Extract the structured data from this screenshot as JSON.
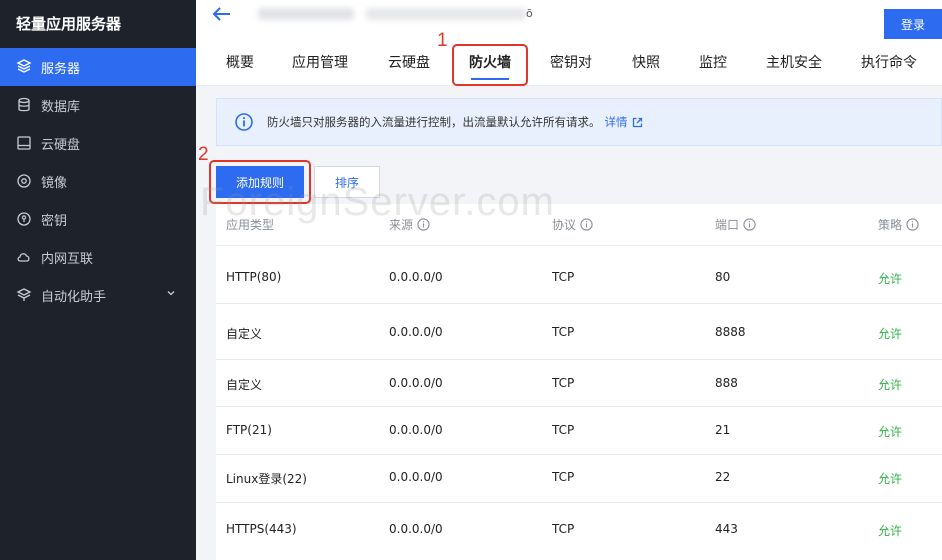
{
  "sidebar": {
    "brand": "轻量应用服务器",
    "items": [
      {
        "label": "服务器",
        "icon": "server-icon"
      },
      {
        "label": "数据库",
        "icon": "database-icon"
      },
      {
        "label": "云硬盘",
        "icon": "disk-icon"
      },
      {
        "label": "镜像",
        "icon": "image-icon"
      },
      {
        "label": "密钥",
        "icon": "key-icon"
      },
      {
        "label": "内网互联",
        "icon": "cloud-link-icon"
      },
      {
        "label": "自动化助手",
        "icon": "automation-icon"
      }
    ]
  },
  "header": {
    "title_fragment": "ō",
    "login_label": "登录"
  },
  "tabs": [
    {
      "label": "概要"
    },
    {
      "label": "应用管理"
    },
    {
      "label": "云硬盘"
    },
    {
      "label": "防火墙"
    },
    {
      "label": "密钥对"
    },
    {
      "label": "快照"
    },
    {
      "label": "监控"
    },
    {
      "label": "主机安全"
    },
    {
      "label": "执行命令"
    }
  ],
  "annotations": {
    "n1": "1",
    "n2": "2"
  },
  "notice": {
    "text": "防火墙只对服务器的入流量进行控制，出流量默认允许所有请求。",
    "link": "详情"
  },
  "actions": {
    "add_rule": "添加规则",
    "sort": "排序"
  },
  "watermark": "ForeignServer.com",
  "table": {
    "columns": [
      "应用类型",
      "来源",
      "协议",
      "端口",
      "策略"
    ],
    "rows": [
      {
        "type": "HTTP(80)",
        "source": "0.0.0.0/0",
        "protocol": "TCP",
        "port": "80",
        "policy": "允许"
      },
      {
        "type": "自定义",
        "source": "0.0.0.0/0",
        "protocol": "TCP",
        "port": "8888",
        "policy": "允许"
      },
      {
        "type": "自定义",
        "source": "0.0.0.0/0",
        "protocol": "TCP",
        "port": "888",
        "policy": "允许"
      },
      {
        "type": "FTP(21)",
        "source": "0.0.0.0/0",
        "protocol": "TCP",
        "port": "21",
        "policy": "允许"
      },
      {
        "type": "Linux登录(22)",
        "source": "0.0.0.0/0",
        "protocol": "TCP",
        "port": "22",
        "policy": "允许"
      },
      {
        "type": "HTTPS(443)",
        "source": "0.0.0.0/0",
        "protocol": "TCP",
        "port": "443",
        "policy": "允许"
      }
    ]
  },
  "colors": {
    "accent": "#2d6bf0",
    "sidebar_bg": "#1e222b",
    "allow": "#2fb344",
    "annotation": "#e0352b"
  }
}
